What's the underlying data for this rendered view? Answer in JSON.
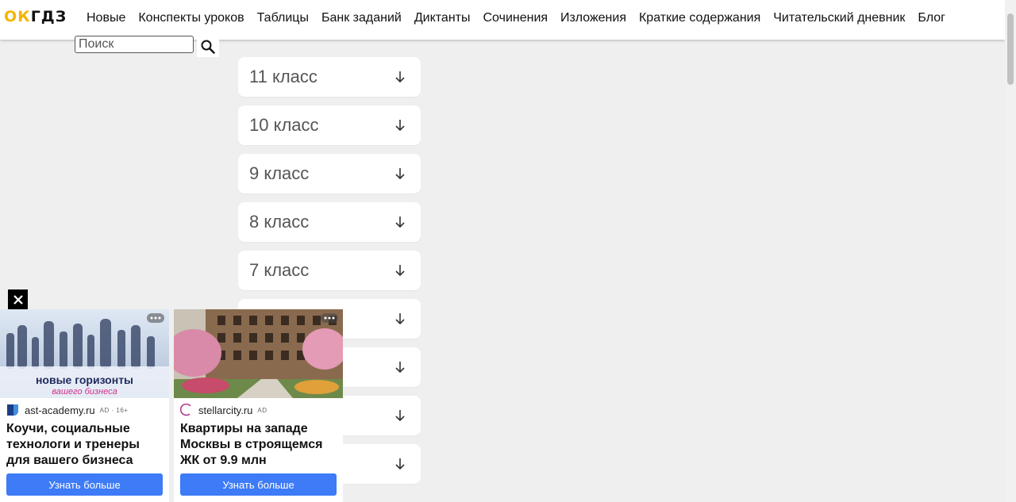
{
  "logo": {
    "part1": "ОК",
    "part2": "ГДЗ"
  },
  "nav": [
    {
      "label": "Новые"
    },
    {
      "label": "Конспекты уроков"
    },
    {
      "label": "Таблицы"
    },
    {
      "label": "Банк заданий"
    },
    {
      "label": "Диктанты"
    },
    {
      "label": "Сочинения"
    },
    {
      "label": "Изложения"
    },
    {
      "label": "Краткие содержания"
    },
    {
      "label": "Читательский дневник"
    },
    {
      "label": "Блог"
    }
  ],
  "search": {
    "placeholder": "Поиск",
    "value": ""
  },
  "grades": [
    {
      "label": "11 класс"
    },
    {
      "label": "10 класс"
    },
    {
      "label": "9 класс"
    },
    {
      "label": "8 класс"
    },
    {
      "label": "7 класс"
    },
    {
      "label": ""
    },
    {
      "label": ""
    },
    {
      "label": ""
    },
    {
      "label": ""
    }
  ],
  "ads": [
    {
      "image_caption": "новые горизонты",
      "image_subcaption": "вашего бизнеса",
      "domain": "ast-academy.ru",
      "tag": "AD · 16+",
      "title": "Коучи, социальные технологи и тренеры для вашего бизнеса",
      "cta": "Узнать больше"
    },
    {
      "domain": "stellarcity.ru",
      "tag": "AD",
      "title": "Квартиры на западе Москвы в строящемся ЖК от 9.9 млн",
      "cta": "Узнать больше"
    }
  ],
  "colors": {
    "accent": "#f5b400",
    "cta": "#3d7bf7",
    "background": "#efefef"
  }
}
